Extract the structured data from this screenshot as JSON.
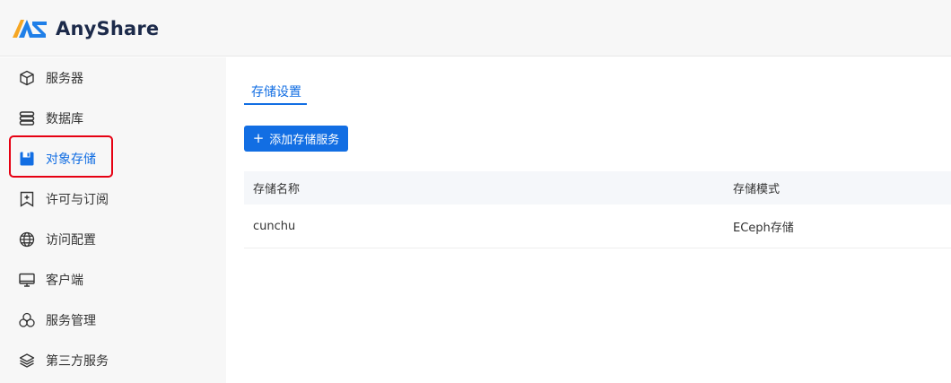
{
  "app": {
    "name": "AnyShare",
    "accent_color": "#126ee3"
  },
  "sidebar": {
    "items": [
      {
        "label": "服务器",
        "icon": "cube-icon",
        "active": false
      },
      {
        "label": "数据库",
        "icon": "database-icon",
        "active": false
      },
      {
        "label": "对象存储",
        "icon": "floppy-disk-icon",
        "active": true
      },
      {
        "label": "许可与订阅",
        "icon": "bookmark-plus-icon",
        "active": false
      },
      {
        "label": "访问配置",
        "icon": "globe-icon",
        "active": false
      },
      {
        "label": "客户端",
        "icon": "monitor-icon",
        "active": false
      },
      {
        "label": "服务管理",
        "icon": "cluster-icon",
        "active": false
      },
      {
        "label": "第三方服务",
        "icon": "layers-icon",
        "active": false
      }
    ]
  },
  "main": {
    "tab": "存储设置",
    "add_button": {
      "icon": "plus-icon",
      "label": "添加存储服务"
    },
    "table": {
      "columns": [
        "存储名称",
        "存储模式"
      ],
      "rows": [
        [
          "cunchu",
          "ECeph存储"
        ]
      ]
    }
  },
  "annotation": {
    "color": "#e60012"
  }
}
